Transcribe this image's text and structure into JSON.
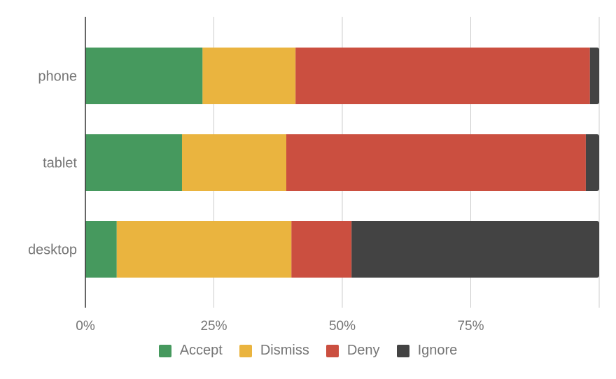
{
  "chart_data": {
    "type": "bar",
    "orientation": "horizontal",
    "stacked": true,
    "percent_stacked": true,
    "title": "",
    "xlabel": "",
    "ylabel": "",
    "xlim": [
      0,
      100
    ],
    "x_ticks": [
      "0%",
      "25%",
      "50%",
      "75%"
    ],
    "grid": true,
    "legend_position": "bottom",
    "categories": [
      "phone",
      "tablet",
      "desktop"
    ],
    "series": [
      {
        "name": "Accept",
        "color": "#46995e",
        "values": [
          22.8,
          18.8,
          6.1
        ]
      },
      {
        "name": "Dismiss",
        "color": "#eab43f",
        "values": [
          18.1,
          20.3,
          34.0
        ]
      },
      {
        "name": "Deny",
        "color": "#cb4f40",
        "values": [
          57.3,
          58.3,
          11.7
        ]
      },
      {
        "name": "Ignore",
        "color": "#434343",
        "values": [
          1.8,
          2.6,
          48.2
        ]
      }
    ]
  }
}
